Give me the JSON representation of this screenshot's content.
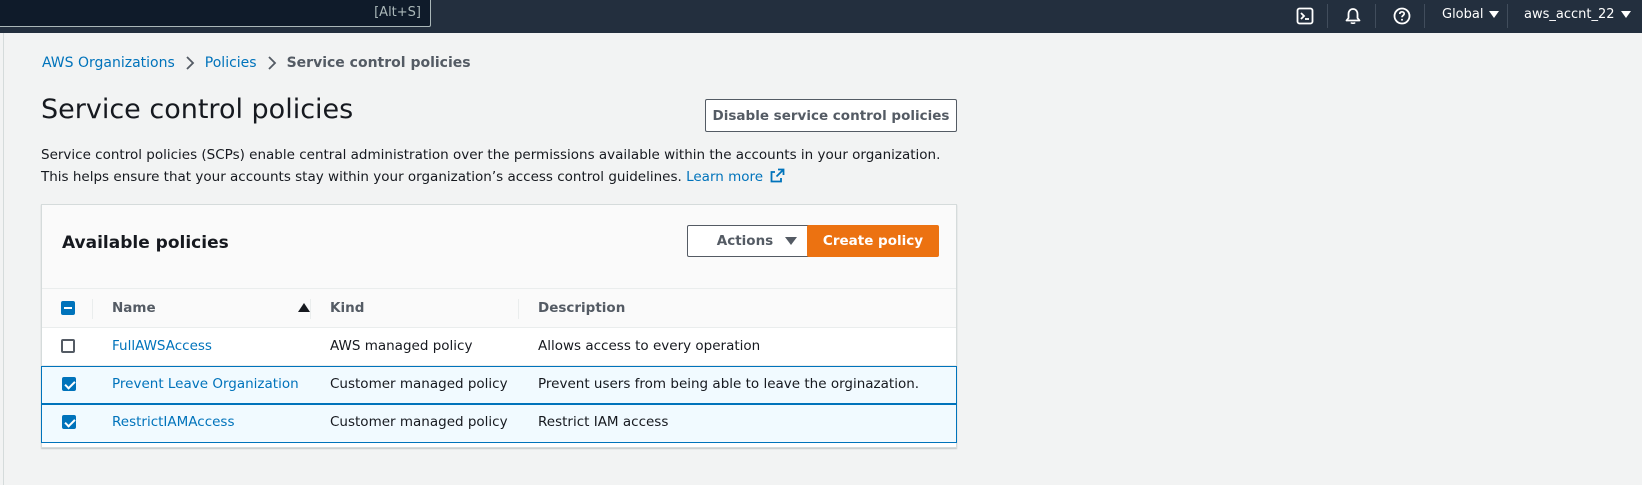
{
  "topnav": {
    "search_shortcut": "[Alt+S]",
    "region": "Global",
    "account": "aws_accnt_22",
    "icons": [
      "cloudshell-icon",
      "bell-icon",
      "help-icon"
    ]
  },
  "breadcrumb": {
    "items": [
      "AWS Organizations",
      "Policies"
    ],
    "current": "Service control policies"
  },
  "page": {
    "title": "Service control policies",
    "disable_button": "Disable service control policies",
    "description": "Service control policies (SCPs) enable central administration over the permissions available within the accounts in your organization. This helps ensure that your accounts stay within your organization’s access control guidelines.",
    "learn_more": "Learn more"
  },
  "card": {
    "title": "Available policies",
    "actions_button": "Actions",
    "create_button": "Create policy"
  },
  "table": {
    "columns": [
      "Name",
      "Kind",
      "Description"
    ],
    "sort_column": "Name",
    "sort_direction": "ascending",
    "rows": [
      {
        "name": "FullAWSAccess",
        "kind": "AWS managed policy",
        "description": "Allows access to every operation",
        "selected": false
      },
      {
        "name": "Prevent Leave Organization",
        "kind": "Customer managed policy",
        "description": "Prevent users from being able to leave the orginazation.",
        "selected": true
      },
      {
        "name": "RestrictIAMAccess",
        "kind": "Customer managed policy",
        "description": "Restrict IAM access",
        "selected": true
      }
    ]
  },
  "colors": {
    "topbar": "#232f3e",
    "link": "#0073bb",
    "primary_button": "#ec7211",
    "selected_row_bg": "#f1faff"
  }
}
